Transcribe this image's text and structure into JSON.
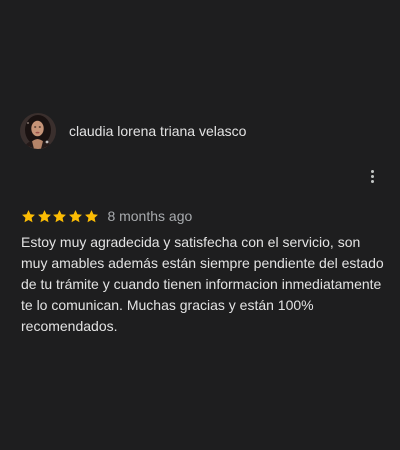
{
  "review": {
    "reviewer_name": "claudia lorena triana velasco",
    "avatar_icon": "reviewer-avatar",
    "rating": 5,
    "rating_max": 5,
    "star_color": "#fbbc04",
    "timestamp": "8 months ago",
    "text": "Estoy muy agradecida y satisfecha con el servicio, son muy amables además están siempre pendiente del estado de tu trámite y cuando tienen informacion inmediatamente te lo comunican. Muchas gracias y están 100% recomendados.",
    "more_options_icon": "more-vertical-icon"
  }
}
